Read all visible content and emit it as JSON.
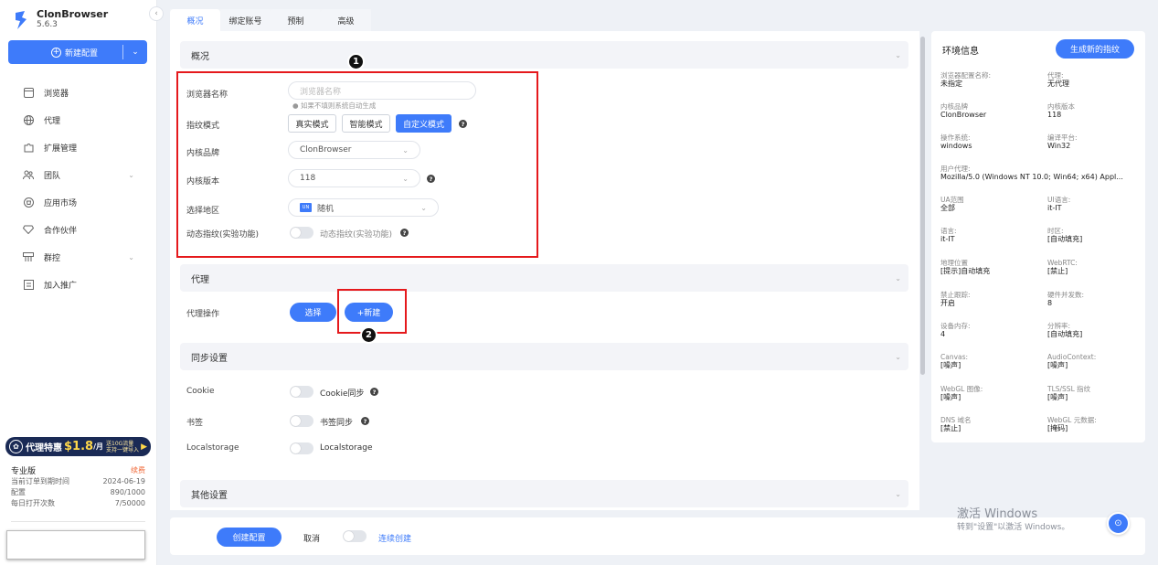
{
  "app": {
    "name": "ClonBrowser",
    "version": "5.6.3"
  },
  "sidebar": {
    "new_config_label": "新建配置",
    "items": [
      {
        "label": "浏览器",
        "icon": "browser-icon",
        "expandable": false
      },
      {
        "label": "代理",
        "icon": "globe-icon",
        "expandable": false
      },
      {
        "label": "扩展管理",
        "icon": "puzzle-icon",
        "expandable": false
      },
      {
        "label": "团队",
        "icon": "team-icon",
        "expandable": true
      },
      {
        "label": "应用市场",
        "icon": "store-icon",
        "expandable": false
      },
      {
        "label": "合作伙伴",
        "icon": "diamond-icon",
        "expandable": false
      },
      {
        "label": "群控",
        "icon": "group-control-icon",
        "expandable": true
      },
      {
        "label": "加入推广",
        "icon": "promote-icon",
        "expandable": false
      }
    ],
    "promo": {
      "prefix": "代理特惠",
      "price": "$1.8",
      "unit": "/月",
      "line1": "送10G流量",
      "line2": "支持一键导入"
    },
    "plan": {
      "title": "专业版",
      "renew": "续费",
      "rows": [
        {
          "k": "当前订单到期时间",
          "v": "2024-06-19"
        },
        {
          "k": "配置",
          "v": "890/1000"
        },
        {
          "k": "每日打开次数",
          "v": "7/50000"
        }
      ]
    }
  },
  "tabs": [
    {
      "label": "概况",
      "active": true
    },
    {
      "label": "绑定账号",
      "active": false
    },
    {
      "label": "预制",
      "active": false
    },
    {
      "label": "高级",
      "active": false
    }
  ],
  "overview": {
    "title": "概况",
    "browser_name": {
      "label": "浏览器名称",
      "placeholder": "浏览器名称",
      "hint": "如果不填则系统自动生成"
    },
    "fingerprint_mode": {
      "label": "指纹模式",
      "options": [
        "真实模式",
        "智能模式",
        "自定义模式"
      ],
      "selected": "自定义模式"
    },
    "kernel_brand": {
      "label": "内核品牌",
      "value": "ClonBrowser"
    },
    "kernel_version": {
      "label": "内核版本",
      "value": "118"
    },
    "region": {
      "label": "选择地区",
      "flag": "UN",
      "value": "随机"
    },
    "dynamic_fp": {
      "label": "动态指纹(实验功能)",
      "toggle_label": "动态指纹(实验功能)"
    }
  },
  "proxy": {
    "title": "代理",
    "label": "代理操作",
    "select_btn": "选择",
    "new_btn": "+新建"
  },
  "sync": {
    "title": "同步设置",
    "rows": [
      {
        "label": "Cookie",
        "toggle": "Cookie同步",
        "help": true
      },
      {
        "label": "书签",
        "toggle": "书签同步",
        "help": true
      },
      {
        "label": "Localstorage",
        "toggle": "Localstorage",
        "help": false
      }
    ]
  },
  "other": {
    "title": "其他设置"
  },
  "footer": {
    "create": "创建配置",
    "cancel": "取消",
    "continuous": "连续创建"
  },
  "annotations": [
    "1",
    "2"
  ],
  "env": {
    "title": "环境信息",
    "generate_btn": "生成新的指纹",
    "left": [
      {
        "k": "浏览器配置名称:",
        "v": "未指定"
      },
      {
        "k": "内核品牌",
        "v": "ClonBrowser"
      },
      {
        "k": "操作系统:",
        "v": "windows"
      },
      {
        "k": "用户代理:",
        "v": "Mozilla/5.0 (Windows NT 10.0; Win64; x64) Appl..."
      },
      {
        "k": "UA范围",
        "v": "全部"
      },
      {
        "k": "语言:",
        "v": "it-IT"
      },
      {
        "k": "地理位置",
        "v": "[提示]自动填充"
      },
      {
        "k": "禁止跟踪:",
        "v": "开启"
      },
      {
        "k": "设备内存:",
        "v": "4"
      },
      {
        "k": "Canvas:",
        "v": "[噪声]"
      },
      {
        "k": "WebGL 图像:",
        "v": "[噪声]"
      },
      {
        "k": "DNS 域名",
        "v": "[禁止]"
      }
    ],
    "right": [
      {
        "k": "代理:",
        "v": "无代理"
      },
      {
        "k": "内核版本",
        "v": "118"
      },
      {
        "k": "编译平台:",
        "v": "Win32"
      },
      {
        "k": "",
        "v": ""
      },
      {
        "k": "UI语言:",
        "v": "it-IT"
      },
      {
        "k": "时区:",
        "v": "[自动填充]"
      },
      {
        "k": "WebRTC:",
        "v": "[禁止]"
      },
      {
        "k": "硬件并发数:",
        "v": "8"
      },
      {
        "k": "分辨率:",
        "v": "[自动填充]"
      },
      {
        "k": "AudioContext:",
        "v": "[噪声]"
      },
      {
        "k": "TLS/SSL 指纹",
        "v": "[噪声]"
      },
      {
        "k": "WebGL 元数据:",
        "v": "[掩码]"
      }
    ]
  },
  "watermark": {
    "line1": "激活 Windows",
    "line2": "转到\"设置\"以激活 Windows。"
  },
  "colors": {
    "primary": "#3e7bfa",
    "annotation_red": "#e5191c"
  }
}
